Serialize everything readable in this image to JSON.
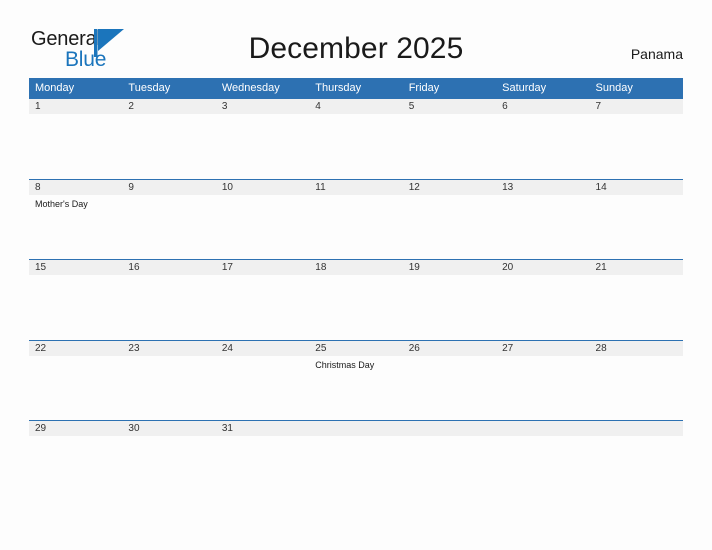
{
  "brand": {
    "name_part1": "General",
    "name_part2": "Blue",
    "flag_icon": "flag-triangle-icon",
    "accent_color": "#1b75bc"
  },
  "header": {
    "title": "December 2025",
    "country": "Panama"
  },
  "colors": {
    "header_blue": "#2d71b2",
    "band_gray": "#f0f0f0",
    "page_background": "#fdfdfd",
    "text_dark": "#1a1a1a"
  },
  "calendar": {
    "weekdays": [
      "Monday",
      "Tuesday",
      "Wednesday",
      "Thursday",
      "Friday",
      "Saturday",
      "Sunday"
    ],
    "weeks": [
      [
        {
          "num": "1",
          "event": ""
        },
        {
          "num": "2",
          "event": ""
        },
        {
          "num": "3",
          "event": ""
        },
        {
          "num": "4",
          "event": ""
        },
        {
          "num": "5",
          "event": ""
        },
        {
          "num": "6",
          "event": ""
        },
        {
          "num": "7",
          "event": ""
        }
      ],
      [
        {
          "num": "8",
          "event": "Mother's Day"
        },
        {
          "num": "9",
          "event": ""
        },
        {
          "num": "10",
          "event": ""
        },
        {
          "num": "11",
          "event": ""
        },
        {
          "num": "12",
          "event": ""
        },
        {
          "num": "13",
          "event": ""
        },
        {
          "num": "14",
          "event": ""
        }
      ],
      [
        {
          "num": "15",
          "event": ""
        },
        {
          "num": "16",
          "event": ""
        },
        {
          "num": "17",
          "event": ""
        },
        {
          "num": "18",
          "event": ""
        },
        {
          "num": "19",
          "event": ""
        },
        {
          "num": "20",
          "event": ""
        },
        {
          "num": "21",
          "event": ""
        }
      ],
      [
        {
          "num": "22",
          "event": ""
        },
        {
          "num": "23",
          "event": ""
        },
        {
          "num": "24",
          "event": ""
        },
        {
          "num": "25",
          "event": "Christmas Day"
        },
        {
          "num": "26",
          "event": ""
        },
        {
          "num": "27",
          "event": ""
        },
        {
          "num": "28",
          "event": ""
        }
      ],
      [
        {
          "num": "29",
          "event": ""
        },
        {
          "num": "30",
          "event": ""
        },
        {
          "num": "31",
          "event": ""
        },
        {
          "num": "",
          "event": ""
        },
        {
          "num": "",
          "event": ""
        },
        {
          "num": "",
          "event": ""
        },
        {
          "num": "",
          "event": ""
        }
      ]
    ]
  }
}
